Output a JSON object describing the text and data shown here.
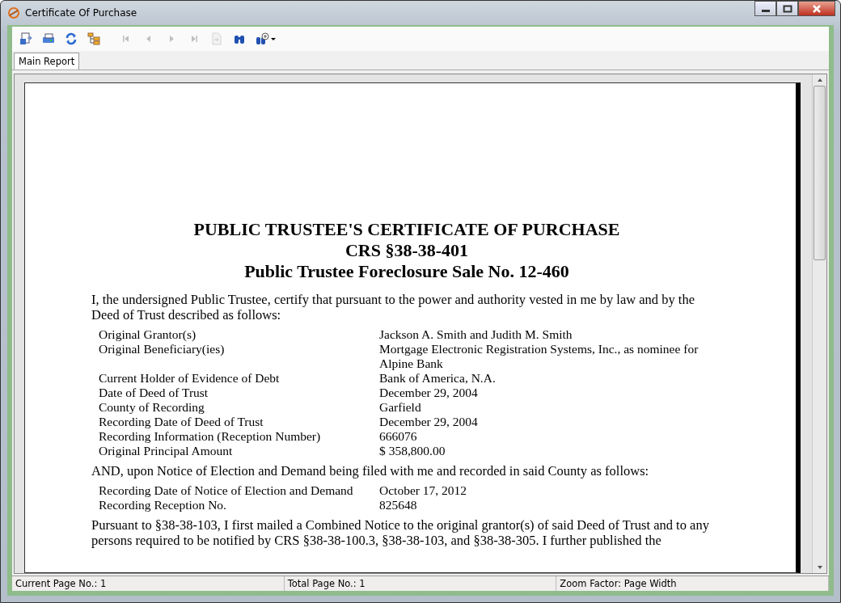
{
  "window": {
    "title": "Certificate Of Purchase"
  },
  "toolbar": [
    {
      "kind": "export",
      "disabled": false
    },
    {
      "kind": "print",
      "disabled": false
    },
    {
      "kind": "refresh",
      "disabled": false
    },
    {
      "kind": "tree",
      "disabled": false
    },
    {
      "kind": "first",
      "disabled": true
    },
    {
      "kind": "prev",
      "disabled": true
    },
    {
      "kind": "next",
      "disabled": true
    },
    {
      "kind": "last",
      "disabled": true
    },
    {
      "kind": "goto",
      "disabled": true
    },
    {
      "kind": "find",
      "disabled": false
    },
    {
      "kind": "zoom",
      "disabled": false
    }
  ],
  "tabs": [
    {
      "label": "Main Report",
      "selected": true
    }
  ],
  "document": {
    "headings": [
      "PUBLIC TRUSTEE'S CERTIFICATE OF PURCHASE",
      "CRS §38-38-401",
      "Public Trustee Foreclosure Sale No. 12-460"
    ],
    "intro": "I, the undersigned Public Trustee, certify that pursuant to the power and authority vested in me by law and by the Deed of Trust described as follows:",
    "fields": [
      {
        "label": "Original Grantor(s)",
        "value": "Jackson A. Smith and Judith M. Smith"
      },
      {
        "label": "Original Beneficiary(ies)",
        "value": "Mortgage Electronic Registration Systems, Inc., as nominee for Alpine Bank"
      },
      {
        "label": "Current Holder of Evidence of Debt",
        "value": "Bank of America, N.A."
      },
      {
        "label": "Date of Deed of Trust",
        "value": "December 29, 2004"
      },
      {
        "label": "County of Recording",
        "value": "Garfield"
      },
      {
        "label": "Recording Date of Deed of Trust",
        "value": "December 29, 2004"
      },
      {
        "label": "Recording Information (Reception Number)",
        "value": "666076"
      },
      {
        "label": "Original Principal Amount",
        "value": "$ 358,800.00"
      }
    ],
    "notice": "AND, upon Notice of Election and Demand being filed with me and recorded in said County as follows:",
    "notice_fields": [
      {
        "label": "Recording Date of Notice of Election and Demand",
        "value": "October 17, 2012"
      },
      {
        "label": "Recording Reception No.",
        "value": "825648"
      }
    ],
    "paragraph": "Pursuant to §38-38-103, I first mailed a Combined Notice to the original grantor(s) of said Deed of Trust and to any persons required to be notified by CRS §38-38-100.3, §38-38-103, and §38-38-305. I further published the"
  },
  "status_bar": [
    "Current Page No.: 1",
    "Total Page No.: 1",
    "Zoom Factor: Page Width"
  ]
}
